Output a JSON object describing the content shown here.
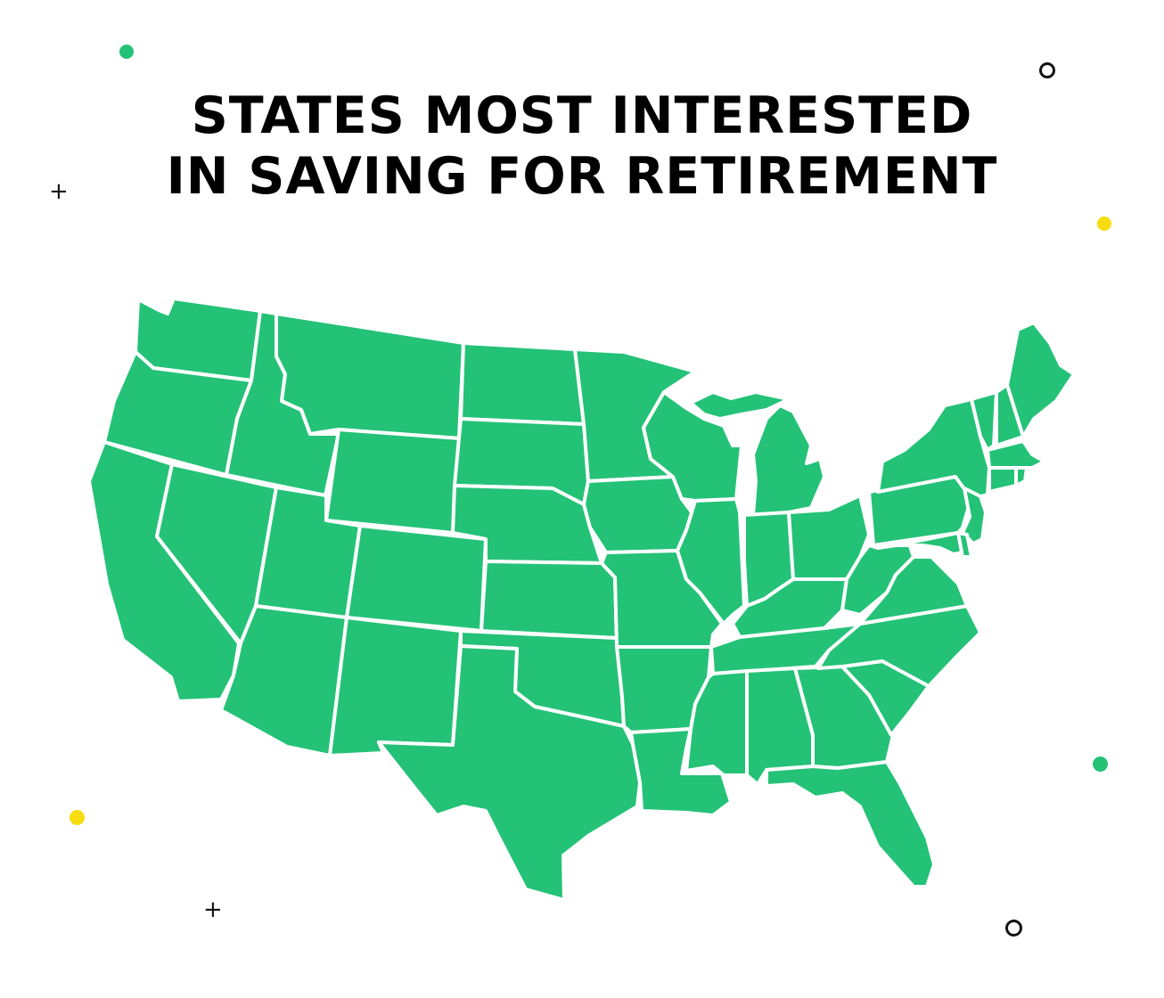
{
  "title": {
    "line1": "STATES MOST INTERESTED",
    "line2": "IN SAVING FOR RETIREMENT"
  },
  "colors": {
    "state_fill": "#24c277",
    "state_border": "#ffffff",
    "dot_green": "#24c277",
    "dot_yellow": "#f7dc0f",
    "ink": "#111111"
  },
  "decorations": {
    "plus_symbol": "+"
  },
  "map": {
    "type": "choropleth",
    "region": "contiguous United States",
    "all_states_same_color": true
  }
}
